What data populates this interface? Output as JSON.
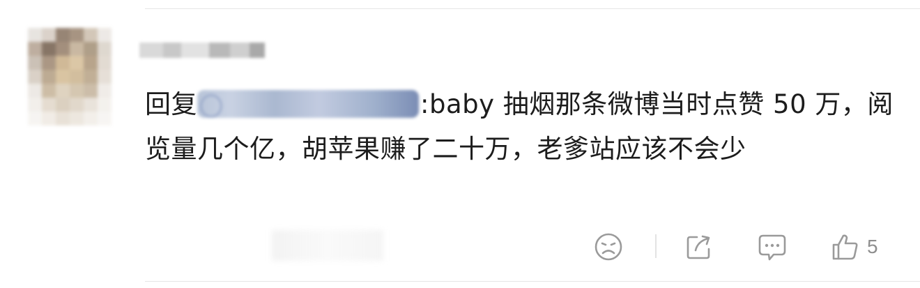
{
  "comment": {
    "prefix": "回复",
    "mention_at": "@",
    "text": ":baby 抽烟那条微博当时点赞 50 万，阅览量几个亿，胡苹果赚了二十万，老爹站应该不会少"
  },
  "actions": {
    "dislike_icon": "sad-face-icon",
    "share_icon": "share-icon",
    "comment_icon": "comment-icon",
    "like_icon": "thumbs-up-icon",
    "like_count": "5"
  },
  "colors": {
    "text": "#1c1c1c",
    "icon": "#9a9a9a",
    "mention_blur": "#aab8d0"
  }
}
